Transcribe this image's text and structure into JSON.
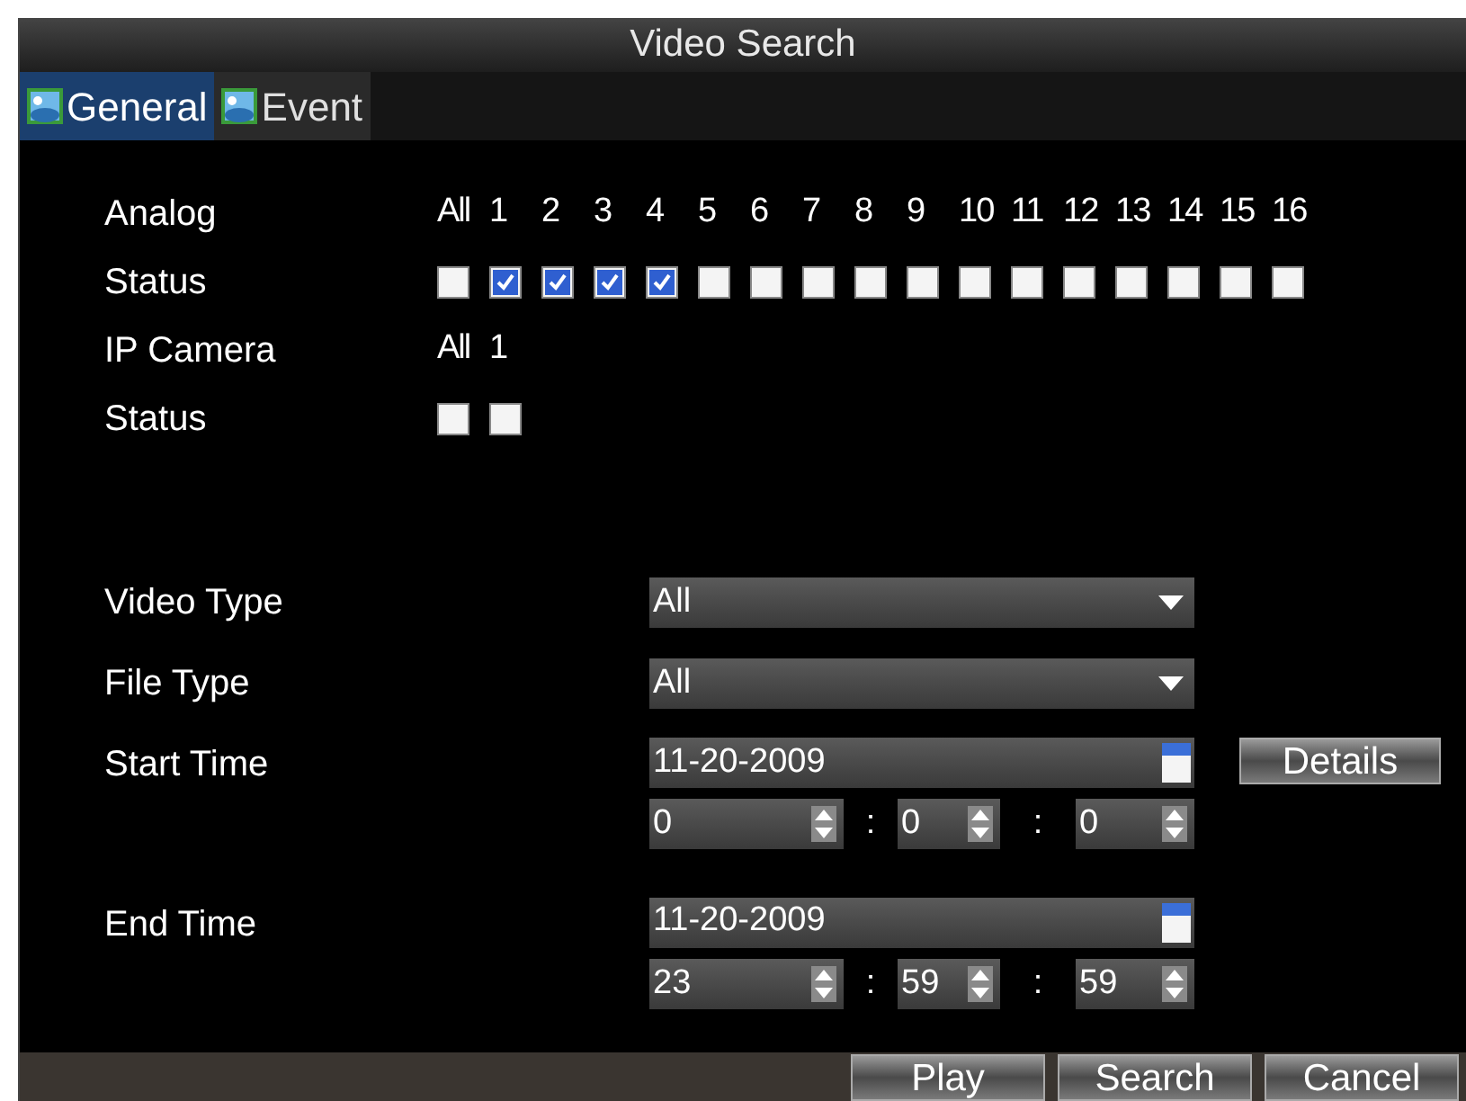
{
  "window": {
    "title": "Video Search"
  },
  "tabs": [
    {
      "label": "General",
      "selected": true
    },
    {
      "label": "Event",
      "selected": false
    }
  ],
  "analog": {
    "label": "Analog",
    "status_label": "Status",
    "channels": [
      {
        "label": "All",
        "checked": false
      },
      {
        "label": "1",
        "checked": true
      },
      {
        "label": "2",
        "checked": true
      },
      {
        "label": "3",
        "checked": true
      },
      {
        "label": "4",
        "checked": true
      },
      {
        "label": "5",
        "checked": false
      },
      {
        "label": "6",
        "checked": false
      },
      {
        "label": "7",
        "checked": false
      },
      {
        "label": "8",
        "checked": false
      },
      {
        "label": "9",
        "checked": false
      },
      {
        "label": "10",
        "checked": false
      },
      {
        "label": "11",
        "checked": false
      },
      {
        "label": "12",
        "checked": false
      },
      {
        "label": "13",
        "checked": false
      },
      {
        "label": "14",
        "checked": false
      },
      {
        "label": "15",
        "checked": false
      },
      {
        "label": "16",
        "checked": false
      }
    ]
  },
  "ip_camera": {
    "label": "IP Camera",
    "status_label": "Status",
    "channels": [
      {
        "label": "All",
        "checked": false
      },
      {
        "label": "1",
        "checked": false
      }
    ]
  },
  "video_type": {
    "label": "Video Type",
    "value": "All"
  },
  "file_type": {
    "label": "File Type",
    "value": "All"
  },
  "start_time": {
    "label": "Start Time",
    "date": "11-20-2009",
    "hour": "0",
    "separator_1": ":",
    "minute": "0",
    "separator_2": ":",
    "second": "0",
    "details_button": "Details"
  },
  "end_time": {
    "label": "End Time",
    "date": "11-20-2009",
    "hour": "23",
    "separator_1": ":",
    "minute": "59",
    "separator_2": ":",
    "second": "59"
  },
  "buttons": [
    "Play",
    "Search",
    "Cancel"
  ]
}
